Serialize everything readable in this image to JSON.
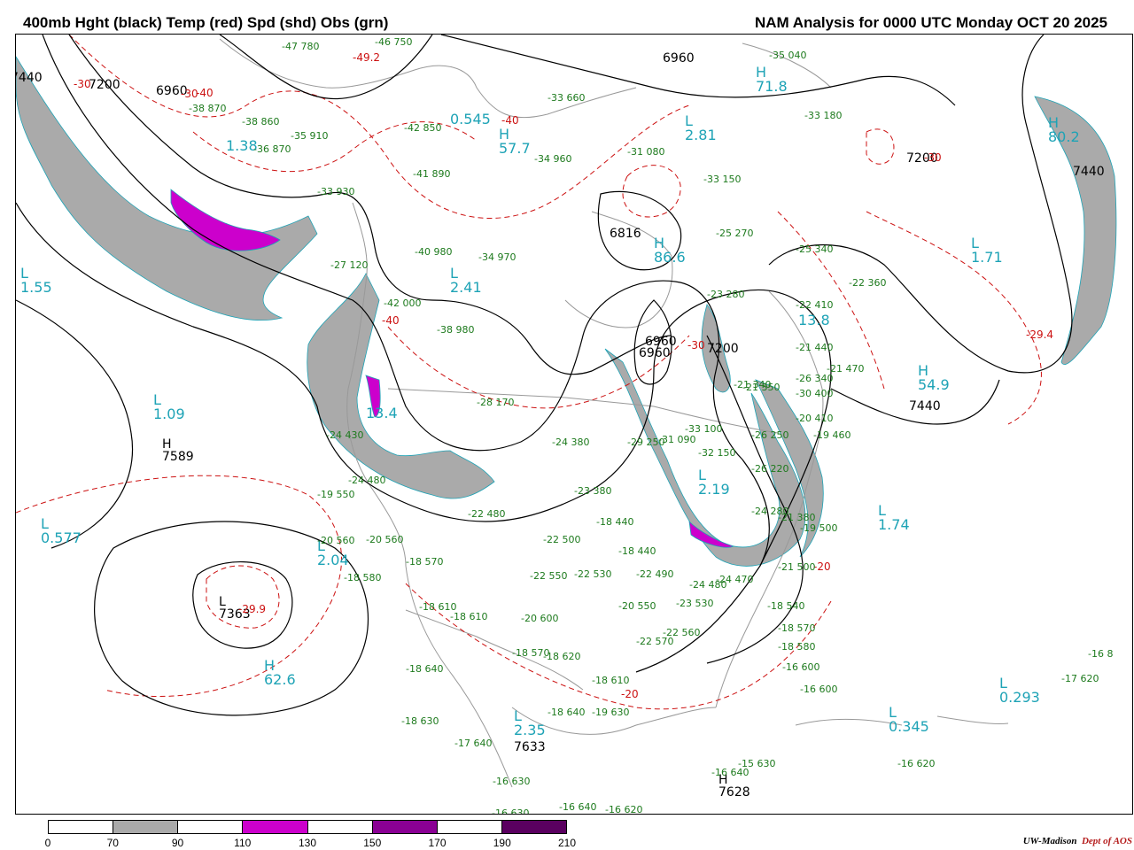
{
  "header": {
    "title_left": "400mb Hght (black) Temp (red) Spd (shd) Obs (grn)",
    "title_right": "NAM Analysis for 0000 UTC Monday  OCT 20 2025"
  },
  "colorbar": {
    "ticks": [
      "0",
      "70",
      "90",
      "110",
      "130",
      "150",
      "170",
      "190",
      "210"
    ],
    "segments": [
      {
        "from": 0,
        "to": 70,
        "color": "#ffffff"
      },
      {
        "from": 70,
        "to": 90,
        "color": "#aaaaaa"
      },
      {
        "from": 90,
        "to": 110,
        "color": "#ffffff"
      },
      {
        "from": 110,
        "to": 130,
        "color": "#cc00cc"
      },
      {
        "from": 130,
        "to": 150,
        "color": "#ffffff"
      },
      {
        "from": 150,
        "to": 170,
        "color": "#8a0094"
      },
      {
        "from": 170,
        "to": 190,
        "color": "#ffffff"
      },
      {
        "from": 190,
        "to": 210,
        "color": "#5a0060"
      }
    ]
  },
  "credit": {
    "org": "UW-Madison",
    "dept": "Dept of AOS"
  },
  "colors": {
    "height": "#000000",
    "temp": "#cc1111",
    "shade_70_90": "#aaaaaa",
    "shade_110_130": "#cc00cc",
    "obs": "#1d7a1d",
    "pressure_centers": "#1ea3b6",
    "geography": "#999999"
  },
  "centers": [
    {
      "symbol": "H",
      "value": "80.2"
    },
    {
      "symbol": "H",
      "value": "86.6"
    },
    {
      "symbol": "H",
      "value": "54.9"
    },
    {
      "symbol": "H",
      "value": "62.6"
    },
    {
      "symbol": "H",
      "value": "57.7"
    },
    {
      "symbol": "H",
      "value": "71.8"
    },
    {
      "symbol": "H",
      "value": "13.4"
    },
    {
      "symbol": "L",
      "value": "1.55"
    },
    {
      "symbol": "L",
      "value": "1.09"
    },
    {
      "symbol": "L",
      "value": "0.577"
    },
    {
      "symbol": "L",
      "value": "2.04"
    },
    {
      "symbol": "L",
      "value": "2.81"
    },
    {
      "symbol": "L",
      "value": "2.41"
    },
    {
      "symbol": "L",
      "value": "1.71"
    },
    {
      "symbol": "L",
      "value": "1.74"
    },
    {
      "symbol": "L",
      "value": "0.293"
    },
    {
      "symbol": "L",
      "value": "0.345"
    },
    {
      "symbol": "L",
      "value": "2.35"
    },
    {
      "symbol": "L",
      "value": "1.38"
    },
    {
      "symbol": "L",
      "value": "0.545"
    },
    {
      "symbol": "H",
      "value": "13.8"
    },
    {
      "symbol": "L",
      "value": "2.19"
    }
  ],
  "height_labels": [
    "7440",
    "7200",
    "6960",
    "6960",
    "7200",
    "6960",
    "6816",
    "7589",
    "7363",
    "7633",
    "7628",
    "7440",
    "7200",
    "7440",
    "6960"
  ],
  "temp_labels": [
    "-30",
    "-40",
    "-49.2",
    "-40",
    "-30",
    "-40",
    "-30",
    "-29.4",
    "-30",
    "-29.9",
    "-20",
    "-20"
  ],
  "observations": [
    "-47 780",
    "-46 750",
    "-38 870",
    "-38 860",
    "-35 910",
    "-36 870",
    "-33 930",
    "-42 850",
    "-41 890",
    "-40 980",
    "-34 970",
    "-33 660",
    "-34 960",
    "-31 080",
    "-33 150",
    "-35 040",
    "-33 180",
    "-25 270",
    "-23 280",
    "-25 340",
    "-22 410",
    "-22 360",
    "-21 440",
    "-21 470",
    "-21 340",
    "-20 410",
    "-19 460",
    "-27 120",
    "-42 000",
    "-38 980",
    "-28 170",
    "-24 380",
    "-29 250",
    "-31 090",
    "-33 100",
    "-32 150",
    "-26 220",
    "-26 250",
    "-24 280",
    "-21 380",
    "-24 430",
    "-24 480",
    "-19 550",
    "-20 560",
    "-20 560",
    "-18 580",
    "-18 570",
    "-18 610",
    "-18 610",
    "-18 640",
    "-18 630",
    "-17 640",
    "-16 630",
    "-16 630",
    "-16 640",
    "-16 620",
    "-22 480",
    "-22 500",
    "-22 530",
    "-22 550",
    "-23 380",
    "-18 440",
    "-18 440",
    "-22 490",
    "-20 550",
    "-23 530",
    "-22 570",
    "-22 560",
    "-24 480",
    "-24 470",
    "-21 500",
    "-19 500",
    "-18 540",
    "-18 570",
    "-18 580",
    "-16 600",
    "-16 600",
    "-17 620",
    "-16 8",
    "-18 620",
    "-18 610",
    "-18 640",
    "-19 630",
    "-16 640",
    "-15 630",
    "-16 620",
    "-20 600",
    "-18 570",
    "-21 350",
    "-26 340",
    "-30 400"
  ],
  "map_meta": {
    "projection": "lambert conformal",
    "region": "North America",
    "level": "400mb"
  }
}
